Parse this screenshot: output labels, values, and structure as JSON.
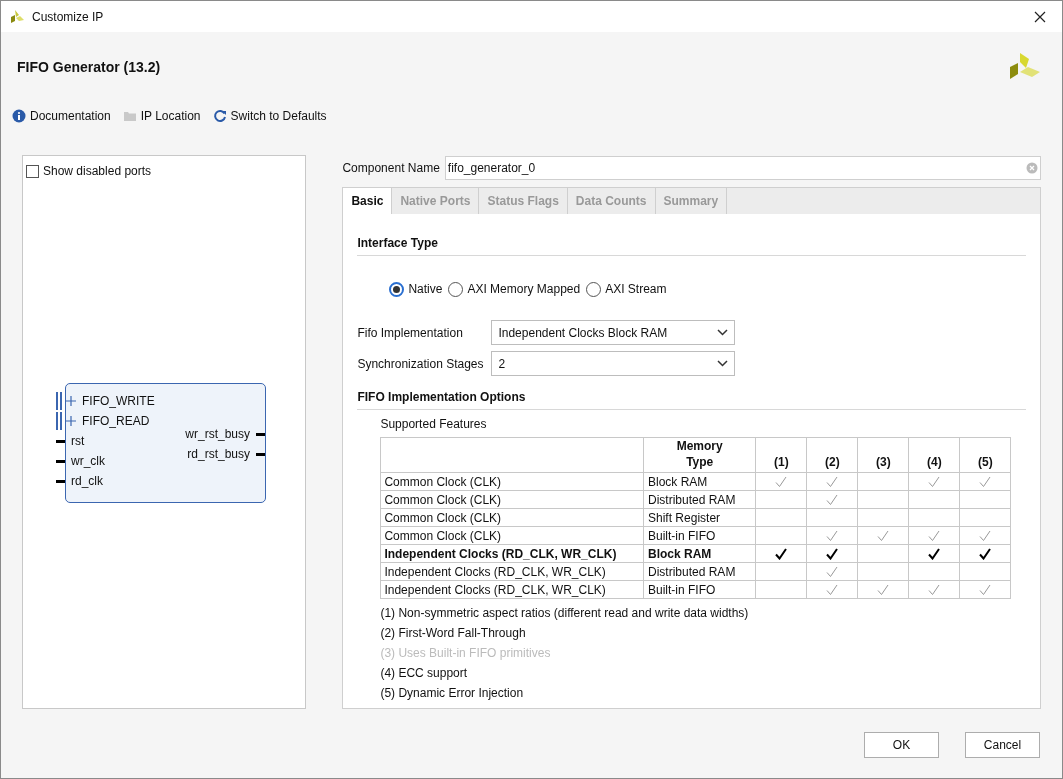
{
  "window": {
    "title": "Customize IP"
  },
  "header": {
    "title": "FIFO Generator (13.2)"
  },
  "toolbar": [
    {
      "label": "Documentation",
      "kind": "info",
      "disabled": false
    },
    {
      "label": "IP Location",
      "kind": "folder",
      "disabled": false
    },
    {
      "label": "Switch to Defaults",
      "kind": "refresh",
      "disabled": false
    }
  ],
  "symbol_panel": {
    "show_disabled_ports": {
      "label": "Show disabled ports",
      "checked": false
    },
    "left_ports": [
      {
        "name": "FIFO_WRITE",
        "kind": "bus"
      },
      {
        "name": "FIFO_READ",
        "kind": "bus"
      },
      {
        "name": "rst",
        "kind": "wire"
      },
      {
        "name": "wr_clk",
        "kind": "wire"
      },
      {
        "name": "rd_clk",
        "kind": "wire"
      }
    ],
    "right_ports": [
      {
        "name": "wr_rst_busy",
        "kind": "wire"
      },
      {
        "name": "rd_rst_busy",
        "kind": "wire"
      }
    ]
  },
  "component_name": {
    "label": "Component Name",
    "value": "fifo_generator_0"
  },
  "tabs": [
    {
      "label": "Basic",
      "selected": true
    },
    {
      "label": "Native Ports",
      "selected": false
    },
    {
      "label": "Status Flags",
      "selected": false
    },
    {
      "label": "Data Counts",
      "selected": false
    },
    {
      "label": "Summary",
      "selected": false
    }
  ],
  "interface_type": {
    "title": "Interface Type",
    "options": [
      {
        "label": "Native",
        "selected": true
      },
      {
        "label": "AXI Memory Mapped",
        "selected": false
      },
      {
        "label": "AXI Stream",
        "selected": false
      }
    ]
  },
  "fields": [
    {
      "label": "Fifo Implementation",
      "value": "Independent Clocks Block RAM"
    },
    {
      "label": "Synchronization Stages",
      "value": "2"
    }
  ],
  "implementation_options": {
    "title": "FIFO Implementation Options",
    "subtitle": "Supported Features",
    "columns": [
      "",
      "Memory Type",
      "(1)",
      "(2)",
      "(3)",
      "(4)",
      "(5)"
    ],
    "rows": [
      {
        "clock": "Common Clock (CLK)",
        "memory": "Block RAM",
        "features": [
          true,
          true,
          false,
          true,
          true
        ],
        "selected": false
      },
      {
        "clock": "Common Clock (CLK)",
        "memory": "Distributed RAM",
        "features": [
          false,
          true,
          false,
          false,
          false
        ],
        "selected": false
      },
      {
        "clock": "Common Clock (CLK)",
        "memory": "Shift Register",
        "features": [
          false,
          false,
          false,
          false,
          false
        ],
        "selected": false
      },
      {
        "clock": "Common Clock (CLK)",
        "memory": "Built-in FIFO",
        "features": [
          false,
          true,
          true,
          true,
          true
        ],
        "selected": false
      },
      {
        "clock": "Independent Clocks (RD_CLK, WR_CLK)",
        "memory": "Block RAM",
        "features": [
          true,
          true,
          false,
          true,
          true
        ],
        "selected": true
      },
      {
        "clock": "Independent Clocks (RD_CLK, WR_CLK)",
        "memory": "Distributed RAM",
        "features": [
          false,
          true,
          false,
          false,
          false
        ],
        "selected": false
      },
      {
        "clock": "Independent Clocks (RD_CLK, WR_CLK)",
        "memory": "Built-in FIFO",
        "features": [
          false,
          true,
          true,
          true,
          true
        ],
        "selected": false
      }
    ],
    "notes": [
      {
        "text": "(1) Non-symmetric aspect ratios (different read and write data widths)",
        "disabled": false
      },
      {
        "text": "(2) First-Word Fall-Through",
        "disabled": false
      },
      {
        "text": "(3) Uses Built-in FIFO primitives",
        "disabled": true
      },
      {
        "text": "(4) ECC support",
        "disabled": false
      },
      {
        "text": "(5) Dynamic Error Injection",
        "disabled": false
      }
    ]
  },
  "buttons": [
    {
      "label": "OK"
    },
    {
      "label": "Cancel"
    }
  ]
}
